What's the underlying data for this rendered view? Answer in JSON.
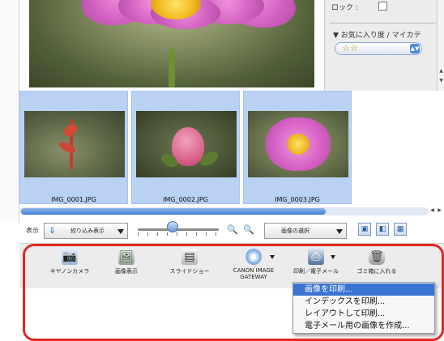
{
  "info_panel": {
    "lock_label": "ロック :",
    "favorites_label": "▼ お気に入り度",
    "favorites_separator": "/",
    "my_category_label": "マイカテ",
    "rating": "☆☆"
  },
  "thumbnails": [
    {
      "filename": "IMG_0001.JPG",
      "subject": "red plant sprout"
    },
    {
      "filename": "IMG_0002.JPG",
      "subject": "pink flower bud"
    },
    {
      "filename": "IMG_0003.JPG",
      "subject": "pink cosmos flower"
    }
  ],
  "controls": {
    "view_label": "表示",
    "filter_value": "絞り込み表示",
    "selection_value": "画像の選択",
    "zoom_out_icon": "zoom-out-icon",
    "zoom_in_icon": "zoom-in-icon"
  },
  "toolbar": {
    "camera": "キヤノンカメラ",
    "view_image": "画像表示",
    "slideshow": "スライドショー",
    "gateway_line1": "CANON IMAGE",
    "gateway_line2": "GATEWAY",
    "print_email": "印刷／電子メール",
    "trash": "ゴミ箱に入れる"
  },
  "print_menu": {
    "items": [
      "画像を印刷...",
      "インデックスを印刷...",
      "レイアウトして印刷...",
      "電子メール用の画像を作成..."
    ],
    "active_index": 0
  },
  "colors": {
    "highlight": "#e0281f",
    "selection": "#b9d2f3",
    "menu_active": "#3a73d1"
  }
}
